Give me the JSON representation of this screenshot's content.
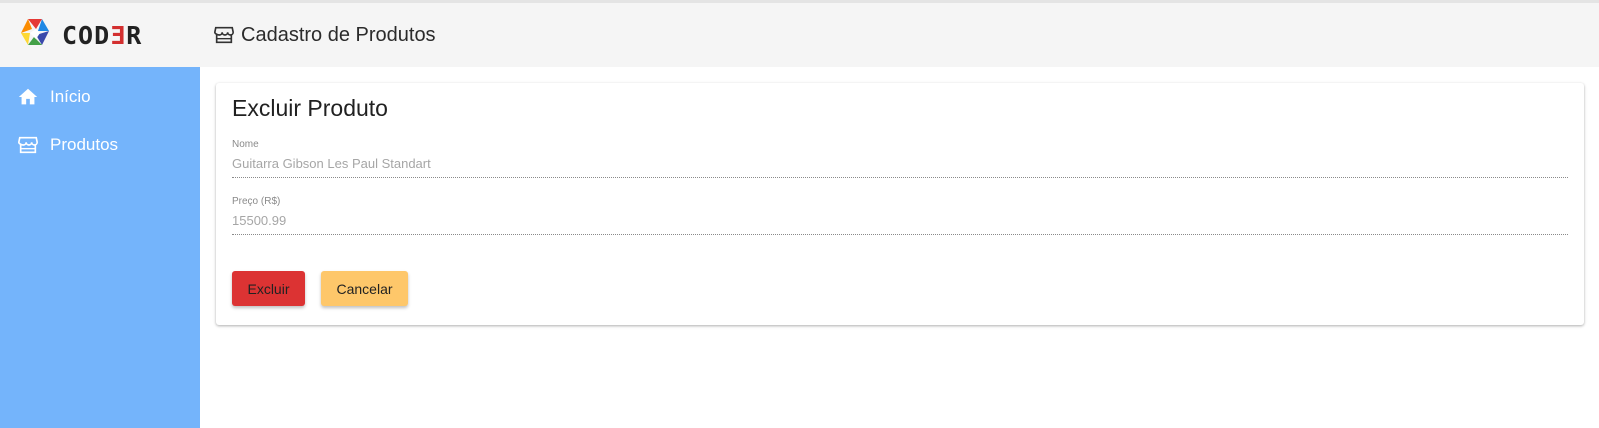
{
  "header": {
    "logo_text": "COD",
    "logo_text_e": "Ǝ",
    "logo_text_end": "R",
    "title": "Cadastro de Produtos",
    "title_icon": "store-icon"
  },
  "sidebar": {
    "items": [
      {
        "label": "Início",
        "icon": "home-icon"
      },
      {
        "label": "Produtos",
        "icon": "store-icon"
      }
    ]
  },
  "card": {
    "title": "Excluir Produto",
    "fields": [
      {
        "label": "Nome",
        "value": "Guitarra Gibson Les Paul Standart"
      },
      {
        "label": "Preço (R$)",
        "value": "15500.99"
      }
    ],
    "buttons": {
      "delete_label": "Excluir",
      "cancel_label": "Cancelar"
    }
  },
  "colors": {
    "sidebar": "#74b4fb",
    "header": "#f5f5f5",
    "delete": "#dc3333",
    "cancel": "#fec76a"
  }
}
